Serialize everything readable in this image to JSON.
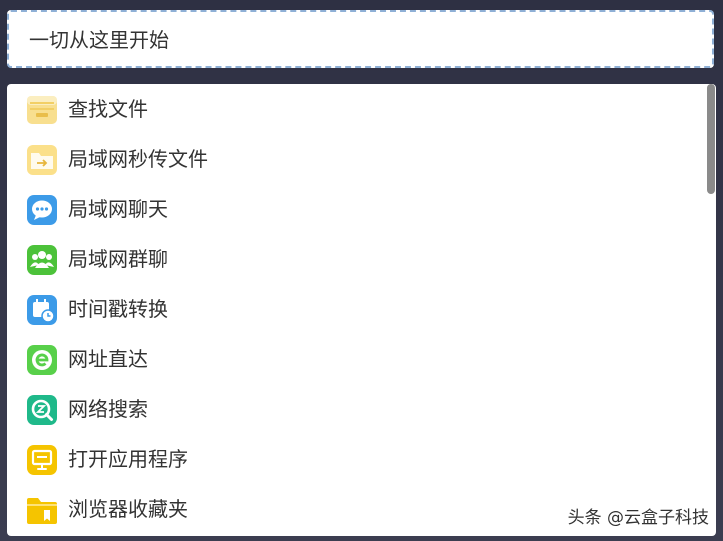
{
  "search": {
    "text": "一切从这里开始"
  },
  "items": [
    {
      "label": "查找文件",
      "icon": "file-cabinet-icon",
      "color": "#f7d87a"
    },
    {
      "label": "局域网秒传文件",
      "icon": "folder-transfer-icon",
      "color": "#f9d86b"
    },
    {
      "label": "局域网聊天",
      "icon": "chat-bubble-icon",
      "color": "#3c9be8"
    },
    {
      "label": "局域网群聊",
      "icon": "group-users-icon",
      "color": "#4cc23a"
    },
    {
      "label": "时间戳转换",
      "icon": "calendar-clock-icon",
      "color": "#3c9be8"
    },
    {
      "label": "网址直达",
      "icon": "browser-e-icon",
      "color": "#58d04a"
    },
    {
      "label": "网络搜索",
      "icon": "search-globe-icon",
      "color": "#1fb98a"
    },
    {
      "label": "打开应用程序",
      "icon": "application-monitor-icon",
      "color": "#f5c400"
    },
    {
      "label": "浏览器收藏夹",
      "icon": "bookmark-folder-icon",
      "color": "#f5c400"
    }
  ],
  "watermark": {
    "text": "头条 @云盒子科技"
  }
}
